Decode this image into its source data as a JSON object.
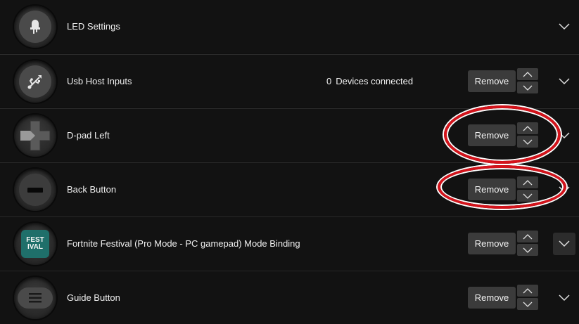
{
  "rows": [
    {
      "label": "LED Settings",
      "icon": "led-icon"
    },
    {
      "label": "Usb Host Inputs",
      "icon": "usb-icon",
      "status_count": "0",
      "status_text": "Devices connected",
      "remove_label": "Remove"
    },
    {
      "label": "D-pad Left",
      "icon": "dpad-icon",
      "remove_label": "Remove"
    },
    {
      "label": "Back Button",
      "icon": "back-button-icon",
      "remove_label": "Remove"
    },
    {
      "label": "Fortnite Festival (Pro Mode - PC gamepad) Mode Binding",
      "icon": "fortnite-festival-logo",
      "logo_text_top": "FEST",
      "logo_text_bottom": "IVAL",
      "remove_label": "Remove"
    },
    {
      "label": "Guide Button",
      "icon": "guide-button-icon",
      "remove_label": "Remove"
    }
  ],
  "colors": {
    "background": "#121212",
    "button": "#3b3b3b",
    "annotation": "#d4131b"
  }
}
